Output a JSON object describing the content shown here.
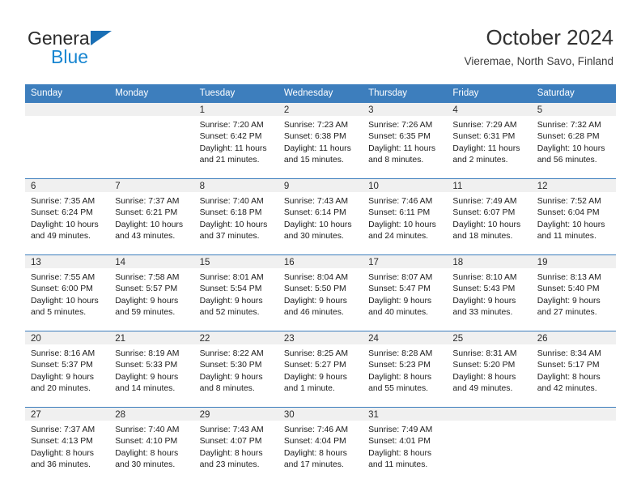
{
  "brand": {
    "name_top": "General",
    "name_bottom": "Blue",
    "triangle_icon": "brand-triangle-icon",
    "color_dark": "#2b2b2b",
    "color_blue": "#1886d1",
    "triangle_color": "#1a6fb5"
  },
  "header": {
    "title": "October 2024",
    "subtitle": "Vieremae, North Savo, Finland"
  },
  "theme": {
    "header_bg": "#3d7ebd",
    "header_text": "#ffffff",
    "daynum_band_bg": "#f0f0f0",
    "grid_line": "#3d7ebd"
  },
  "weekdays": [
    "Sunday",
    "Monday",
    "Tuesday",
    "Wednesday",
    "Thursday",
    "Friday",
    "Saturday"
  ],
  "weeks": [
    [
      {
        "day": "",
        "sunrise": "",
        "sunset": "",
        "daylight_1": "",
        "daylight_2": "",
        "blank": true
      },
      {
        "day": "",
        "sunrise": "",
        "sunset": "",
        "daylight_1": "",
        "daylight_2": "",
        "blank": true
      },
      {
        "day": "1",
        "sunrise": "Sunrise: 7:20 AM",
        "sunset": "Sunset: 6:42 PM",
        "daylight_1": "Daylight: 11 hours",
        "daylight_2": "and 21 minutes.",
        "blank": false
      },
      {
        "day": "2",
        "sunrise": "Sunrise: 7:23 AM",
        "sunset": "Sunset: 6:38 PM",
        "daylight_1": "Daylight: 11 hours",
        "daylight_2": "and 15 minutes.",
        "blank": false
      },
      {
        "day": "3",
        "sunrise": "Sunrise: 7:26 AM",
        "sunset": "Sunset: 6:35 PM",
        "daylight_1": "Daylight: 11 hours",
        "daylight_2": "and 8 minutes.",
        "blank": false
      },
      {
        "day": "4",
        "sunrise": "Sunrise: 7:29 AM",
        "sunset": "Sunset: 6:31 PM",
        "daylight_1": "Daylight: 11 hours",
        "daylight_2": "and 2 minutes.",
        "blank": false
      },
      {
        "day": "5",
        "sunrise": "Sunrise: 7:32 AM",
        "sunset": "Sunset: 6:28 PM",
        "daylight_1": "Daylight: 10 hours",
        "daylight_2": "and 56 minutes.",
        "blank": false
      }
    ],
    [
      {
        "day": "6",
        "sunrise": "Sunrise: 7:35 AM",
        "sunset": "Sunset: 6:24 PM",
        "daylight_1": "Daylight: 10 hours",
        "daylight_2": "and 49 minutes.",
        "blank": false
      },
      {
        "day": "7",
        "sunrise": "Sunrise: 7:37 AM",
        "sunset": "Sunset: 6:21 PM",
        "daylight_1": "Daylight: 10 hours",
        "daylight_2": "and 43 minutes.",
        "blank": false
      },
      {
        "day": "8",
        "sunrise": "Sunrise: 7:40 AM",
        "sunset": "Sunset: 6:18 PM",
        "daylight_1": "Daylight: 10 hours",
        "daylight_2": "and 37 minutes.",
        "blank": false
      },
      {
        "day": "9",
        "sunrise": "Sunrise: 7:43 AM",
        "sunset": "Sunset: 6:14 PM",
        "daylight_1": "Daylight: 10 hours",
        "daylight_2": "and 30 minutes.",
        "blank": false
      },
      {
        "day": "10",
        "sunrise": "Sunrise: 7:46 AM",
        "sunset": "Sunset: 6:11 PM",
        "daylight_1": "Daylight: 10 hours",
        "daylight_2": "and 24 minutes.",
        "blank": false
      },
      {
        "day": "11",
        "sunrise": "Sunrise: 7:49 AM",
        "sunset": "Sunset: 6:07 PM",
        "daylight_1": "Daylight: 10 hours",
        "daylight_2": "and 18 minutes.",
        "blank": false
      },
      {
        "day": "12",
        "sunrise": "Sunrise: 7:52 AM",
        "sunset": "Sunset: 6:04 PM",
        "daylight_1": "Daylight: 10 hours",
        "daylight_2": "and 11 minutes.",
        "blank": false
      }
    ],
    [
      {
        "day": "13",
        "sunrise": "Sunrise: 7:55 AM",
        "sunset": "Sunset: 6:00 PM",
        "daylight_1": "Daylight: 10 hours",
        "daylight_2": "and 5 minutes.",
        "blank": false
      },
      {
        "day": "14",
        "sunrise": "Sunrise: 7:58 AM",
        "sunset": "Sunset: 5:57 PM",
        "daylight_1": "Daylight: 9 hours",
        "daylight_2": "and 59 minutes.",
        "blank": false
      },
      {
        "day": "15",
        "sunrise": "Sunrise: 8:01 AM",
        "sunset": "Sunset: 5:54 PM",
        "daylight_1": "Daylight: 9 hours",
        "daylight_2": "and 52 minutes.",
        "blank": false
      },
      {
        "day": "16",
        "sunrise": "Sunrise: 8:04 AM",
        "sunset": "Sunset: 5:50 PM",
        "daylight_1": "Daylight: 9 hours",
        "daylight_2": "and 46 minutes.",
        "blank": false
      },
      {
        "day": "17",
        "sunrise": "Sunrise: 8:07 AM",
        "sunset": "Sunset: 5:47 PM",
        "daylight_1": "Daylight: 9 hours",
        "daylight_2": "and 40 minutes.",
        "blank": false
      },
      {
        "day": "18",
        "sunrise": "Sunrise: 8:10 AM",
        "sunset": "Sunset: 5:43 PM",
        "daylight_1": "Daylight: 9 hours",
        "daylight_2": "and 33 minutes.",
        "blank": false
      },
      {
        "day": "19",
        "sunrise": "Sunrise: 8:13 AM",
        "sunset": "Sunset: 5:40 PM",
        "daylight_1": "Daylight: 9 hours",
        "daylight_2": "and 27 minutes.",
        "blank": false
      }
    ],
    [
      {
        "day": "20",
        "sunrise": "Sunrise: 8:16 AM",
        "sunset": "Sunset: 5:37 PM",
        "daylight_1": "Daylight: 9 hours",
        "daylight_2": "and 20 minutes.",
        "blank": false
      },
      {
        "day": "21",
        "sunrise": "Sunrise: 8:19 AM",
        "sunset": "Sunset: 5:33 PM",
        "daylight_1": "Daylight: 9 hours",
        "daylight_2": "and 14 minutes.",
        "blank": false
      },
      {
        "day": "22",
        "sunrise": "Sunrise: 8:22 AM",
        "sunset": "Sunset: 5:30 PM",
        "daylight_1": "Daylight: 9 hours",
        "daylight_2": "and 8 minutes.",
        "blank": false
      },
      {
        "day": "23",
        "sunrise": "Sunrise: 8:25 AM",
        "sunset": "Sunset: 5:27 PM",
        "daylight_1": "Daylight: 9 hours",
        "daylight_2": "and 1 minute.",
        "blank": false
      },
      {
        "day": "24",
        "sunrise": "Sunrise: 8:28 AM",
        "sunset": "Sunset: 5:23 PM",
        "daylight_1": "Daylight: 8 hours",
        "daylight_2": "and 55 minutes.",
        "blank": false
      },
      {
        "day": "25",
        "sunrise": "Sunrise: 8:31 AM",
        "sunset": "Sunset: 5:20 PM",
        "daylight_1": "Daylight: 8 hours",
        "daylight_2": "and 49 minutes.",
        "blank": false
      },
      {
        "day": "26",
        "sunrise": "Sunrise: 8:34 AM",
        "sunset": "Sunset: 5:17 PM",
        "daylight_1": "Daylight: 8 hours",
        "daylight_2": "and 42 minutes.",
        "blank": false
      }
    ],
    [
      {
        "day": "27",
        "sunrise": "Sunrise: 7:37 AM",
        "sunset": "Sunset: 4:13 PM",
        "daylight_1": "Daylight: 8 hours",
        "daylight_2": "and 36 minutes.",
        "blank": false
      },
      {
        "day": "28",
        "sunrise": "Sunrise: 7:40 AM",
        "sunset": "Sunset: 4:10 PM",
        "daylight_1": "Daylight: 8 hours",
        "daylight_2": "and 30 minutes.",
        "blank": false
      },
      {
        "day": "29",
        "sunrise": "Sunrise: 7:43 AM",
        "sunset": "Sunset: 4:07 PM",
        "daylight_1": "Daylight: 8 hours",
        "daylight_2": "and 23 minutes.",
        "blank": false
      },
      {
        "day": "30",
        "sunrise": "Sunrise: 7:46 AM",
        "sunset": "Sunset: 4:04 PM",
        "daylight_1": "Daylight: 8 hours",
        "daylight_2": "and 17 minutes.",
        "blank": false
      },
      {
        "day": "31",
        "sunrise": "Sunrise: 7:49 AM",
        "sunset": "Sunset: 4:01 PM",
        "daylight_1": "Daylight: 8 hours",
        "daylight_2": "and 11 minutes.",
        "blank": false
      },
      {
        "day": "",
        "sunrise": "",
        "sunset": "",
        "daylight_1": "",
        "daylight_2": "",
        "blank": true
      },
      {
        "day": "",
        "sunrise": "",
        "sunset": "",
        "daylight_1": "",
        "daylight_2": "",
        "blank": true
      }
    ]
  ]
}
